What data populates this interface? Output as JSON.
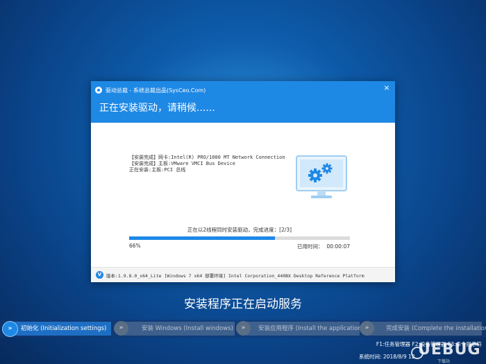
{
  "dialog": {
    "title": "驱动总裁 - 系统总裁出品(SysCeo.Com)",
    "close_symbol": "×",
    "heading": "正在安装驱动，请稍候......",
    "status_lines": [
      "【安装完成】网卡:Intel(R) PRO/1000 MT Network Connection",
      "【安装完成】主板:VMware VMCI Bus Device",
      "正在安装:主板:PCI 总线"
    ],
    "progress_text": "正在以2线程同时安装驱动，完成进度：[2/3]",
    "progress_percent_label": "66%",
    "progress_value": 0.66,
    "elapsed_label": "已用时间：",
    "elapsed_value": "00:00:07",
    "version_icon": "V",
    "version_text": "版本:1.9.8.0_x64_Lite [Windows 7 x64 部署环境] Intel Corporation_440BX Desktop Reference Platform"
  },
  "main_status": "安装程序正在启动服务",
  "steps": [
    {
      "label": "初始化 (Initialization settings)",
      "state": "active"
    },
    {
      "label": "安装 Windows (Install windows)",
      "state": "inactive"
    },
    {
      "label": "安装应用程序 (Install the application)",
      "state": "inactive"
    },
    {
      "label": "完成安装 (Complete the installation)",
      "state": "inactive"
    }
  ],
  "step_icon": "»",
  "hotkeys": "F1:任务管理器 F2:设备管理器 F3:命令提示符",
  "system_time": "系统时间: 2018/8/9 12",
  "watermark": {
    "text": "UEBUG",
    "sub": "下载站"
  },
  "colors": {
    "accent": "#1e88e5",
    "background": "#0d5aa8"
  }
}
